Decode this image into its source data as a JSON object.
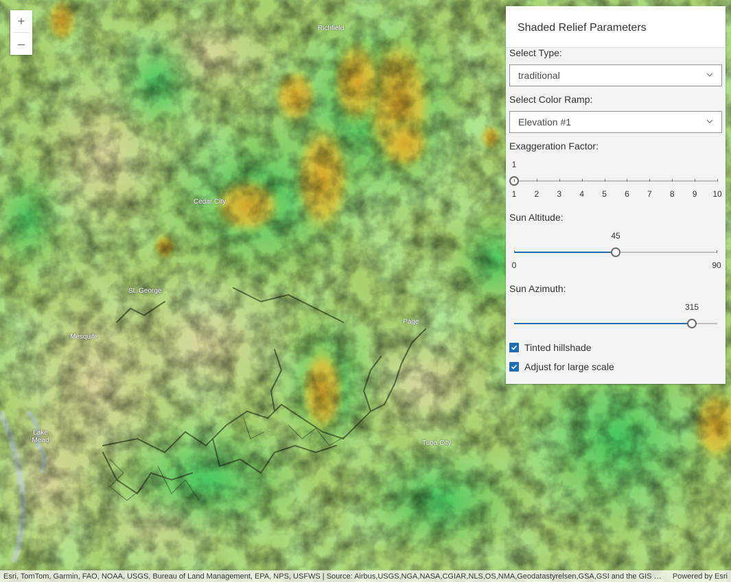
{
  "map": {
    "cities": [
      {
        "name": "Richfield"
      },
      {
        "name": "Cedar City"
      },
      {
        "name": "St. George"
      },
      {
        "name": "Mesquite"
      },
      {
        "name": "Page"
      },
      {
        "name": "Tuba City"
      },
      {
        "name": "Lake Mead"
      }
    ]
  },
  "zoom": {
    "in_label": "+",
    "out_label": "–"
  },
  "panel": {
    "title": "Shaded Relief Parameters",
    "type_label": "Select Type:",
    "type_value": "traditional",
    "ramp_label": "Select Color Ramp:",
    "ramp_value": "Elevation #1",
    "exaggeration": {
      "label": "Exaggeration Factor:",
      "value": "1",
      "value_num": 1,
      "min": 1,
      "max": 10,
      "ticks": [
        "1",
        "2",
        "3",
        "4",
        "5",
        "6",
        "7",
        "8",
        "9",
        "10"
      ]
    },
    "altitude": {
      "label": "Sun Altitude:",
      "value": "45",
      "value_num": 45,
      "min": 0,
      "max": 90,
      "min_label": "0",
      "max_label": "90"
    },
    "azimuth": {
      "label": "Sun Azimuth:",
      "value": "315",
      "value_num": 315,
      "min": 0,
      "max": 360
    },
    "tinted": {
      "label": "Tinted hillshade",
      "checked": true
    },
    "large_scale": {
      "label": "Adjust for large scale",
      "checked": true
    }
  },
  "attribution": {
    "sources": "Esri, TomTom, Garmin, FAO, NOAA, USGS, Bureau of Land Management, EPA, NPS, USFWS | Source: Airbus,USGS,NGA,NASA,CGIAR,NLS,OS,NMA,Geodatastyrelsen,GSA,GSI and the GIS User Community",
    "powered": "Powered by Esri"
  },
  "colors": {
    "accent": "#1f6db3",
    "terrain_low": "#d9d596",
    "terrain_mid": "#7ccf63",
    "terrain_high": "#d9a82a"
  }
}
